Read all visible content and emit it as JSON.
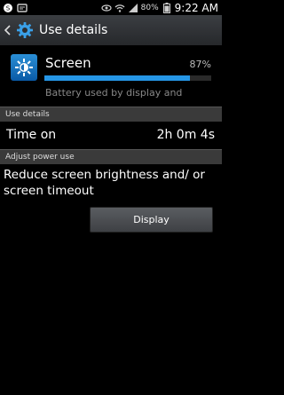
{
  "status_bar": {
    "battery_percent": "80%",
    "time": "9:22 AM",
    "left_icons": [
      "samsung-icon",
      "notification-icon"
    ],
    "right_icons": [
      "eye-icon",
      "wifi-icon",
      "signal-icon",
      "battery-icon"
    ]
  },
  "action_bar": {
    "title": "Use details"
  },
  "app": {
    "name": "Screen",
    "percent": "87%",
    "usage_fraction": 0.87,
    "description": "Battery used by display and"
  },
  "sections": {
    "use_details": "Use details",
    "adjust_power": "Adjust power use"
  },
  "time_on": {
    "label": "Time on",
    "value": "2h 0m 4s"
  },
  "tip": {
    "text": "Reduce screen brightness and/ or screen timeout"
  },
  "button": {
    "label": "Display"
  },
  "colors": {
    "accent": "#2596e6"
  }
}
